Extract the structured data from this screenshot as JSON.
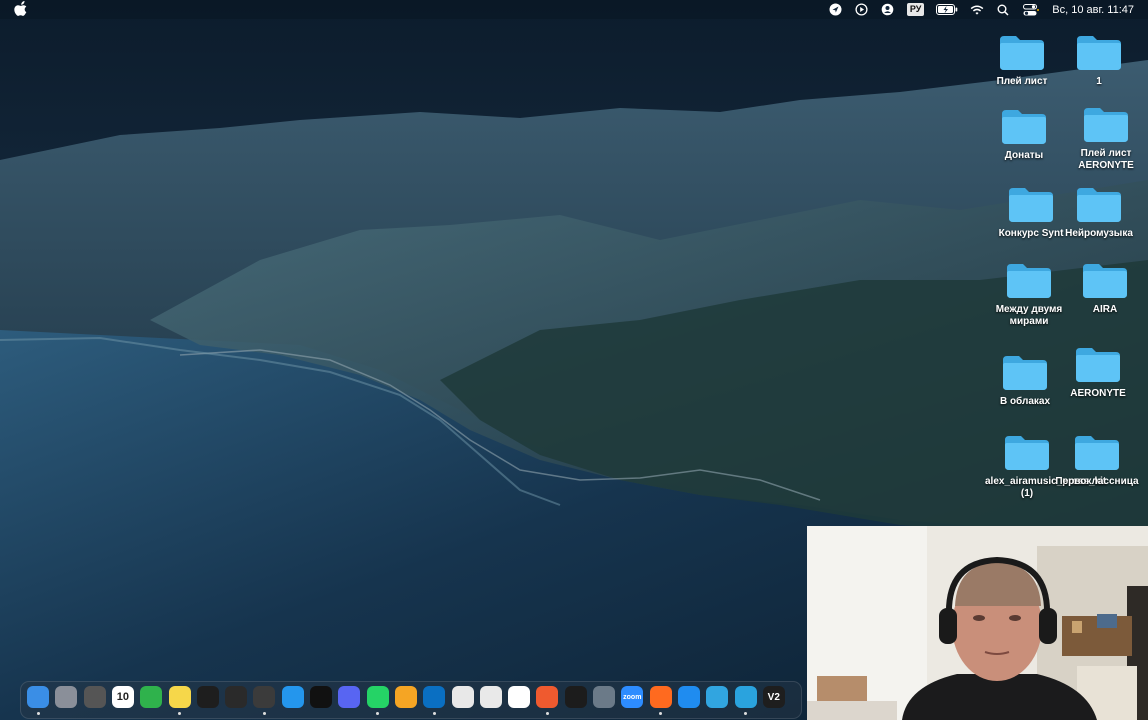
{
  "menubar": {
    "language": "РУ",
    "datetime": "Вс, 10 авг.  11:47"
  },
  "desktop": {
    "folders": [
      {
        "label": "Плей лист"
      },
      {
        "label": "1"
      },
      {
        "label": "Донаты"
      },
      {
        "label": "Плей лист AERONYTE"
      },
      {
        "label": "Конкурс Synt"
      },
      {
        "label": "Нейромузыка"
      },
      {
        "label": "Между двумя мирами"
      },
      {
        "label": "AIRA"
      },
      {
        "label": "В облаках"
      },
      {
        "label": "AERONYTE"
      },
      {
        "label": "alex_airamusic_press_kit (1)"
      },
      {
        "label": "Первоклассница"
      }
    ]
  },
  "dock": {
    "items": [
      {
        "name": "finder-icon",
        "color": "#3a8ee6"
      },
      {
        "name": "launchpad-icon",
        "color": "#8a8f99"
      },
      {
        "name": "calculator-icon",
        "color": "#555"
      },
      {
        "name": "calendar-icon",
        "color": "#ffffff",
        "text": "10"
      },
      {
        "name": "numbers-icon",
        "color": "#2fb24c"
      },
      {
        "name": "notes-icon",
        "color": "#f6d74a"
      },
      {
        "name": "figma-icon",
        "color": "#1e1e1e"
      },
      {
        "name": "xcode-bird-icon",
        "color": "#2a2a2a"
      },
      {
        "name": "time-machine-icon",
        "color": "#3b3b3b"
      },
      {
        "name": "docker-icon",
        "color": "#2496ed"
      },
      {
        "name": "capcut-icon",
        "color": "#111111"
      },
      {
        "name": "discord-icon",
        "color": "#5865f2"
      },
      {
        "name": "whatsapp-icon",
        "color": "#25d366"
      },
      {
        "name": "pages-icon",
        "color": "#f5a524"
      },
      {
        "name": "vscode-icon",
        "color": "#0a6fc2"
      },
      {
        "name": "textedit-icon",
        "color": "#e8e8e8"
      },
      {
        "name": "chrome-icon",
        "color": "#e9e9e9"
      },
      {
        "name": "yandex-browser-icon",
        "color": "#ffffff"
      },
      {
        "name": "pen-icon",
        "color": "#ef5a2f"
      },
      {
        "name": "terminal-icon",
        "color": "#1c1c1c"
      },
      {
        "name": "printer-icon",
        "color": "#6b7a88"
      },
      {
        "name": "zoom-icon",
        "color": "#2d8cff",
        "text": "zoom"
      },
      {
        "name": "firefox-icon",
        "color": "#ff6a1f"
      },
      {
        "name": "safari-icon",
        "color": "#1f8cf0"
      },
      {
        "name": "yandex-messenger-icon",
        "color": "#31a5e0"
      },
      {
        "name": "telegram-icon",
        "color": "#2aa3de"
      },
      {
        "name": "v2-icon",
        "color": "#1e1e1e",
        "text": "V2"
      }
    ]
  },
  "colors": {
    "folder": "#5ec4f6",
    "folder_dark": "#3ea8e0"
  }
}
